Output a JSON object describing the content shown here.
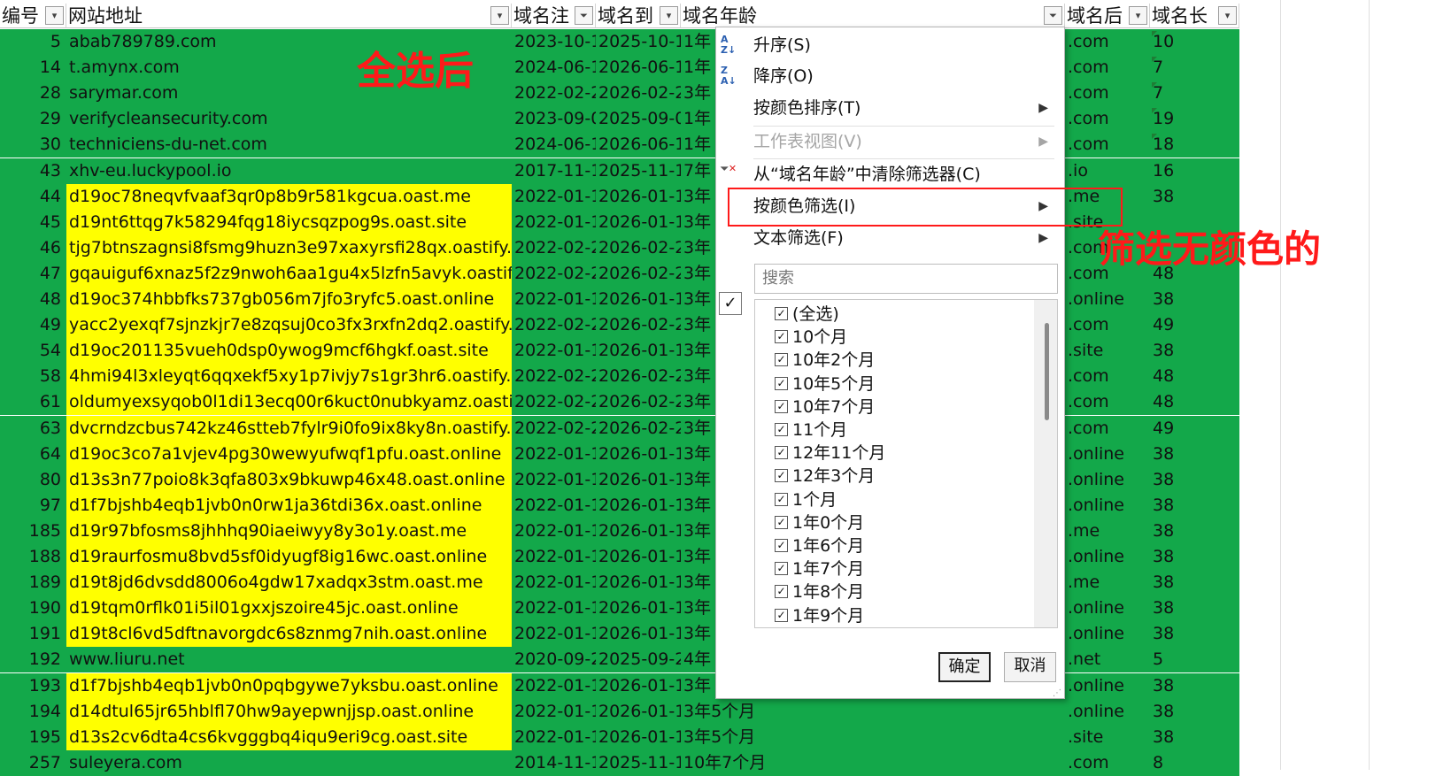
{
  "headers": [
    {
      "label": "编号",
      "filter": "▾"
    },
    {
      "label": "网站地址",
      "filter": "▾"
    },
    {
      "label": "域名注",
      "filter": "⏷"
    },
    {
      "label": "域名到",
      "filter": "▾"
    },
    {
      "label": "域名年龄",
      "filter": "⏷"
    },
    {
      "label": "域名后",
      "filter": "▾"
    },
    {
      "label": "域名长",
      "filter": "▾"
    }
  ],
  "rows": [
    {
      "id": "5",
      "url": "abab789789.com",
      "reg": "2023-10-1",
      "exp": "2025-10-1",
      "age": "1年",
      "tld": ".com",
      "len": "10",
      "hl": false
    },
    {
      "id": "14",
      "url": "t.amynx.com",
      "reg": "2024-06-1",
      "exp": "2026-06-1",
      "age": "1年",
      "tld": ".com",
      "len": "7",
      "hl": false
    },
    {
      "id": "28",
      "url": "sarymar.com",
      "reg": "2022-02-2",
      "exp": "2026-02-2",
      "age": "3年",
      "tld": ".com",
      "len": "7",
      "hl": false
    },
    {
      "id": "29",
      "url": "verifycleansecurity.com",
      "reg": "2023-09-0",
      "exp": "2025-09-0",
      "age": "1年",
      "tld": ".com",
      "len": "19",
      "hl": false
    },
    {
      "id": "30",
      "url": "techniciens-du-net.com",
      "reg": "2024-06-1",
      "exp": "2026-06-1",
      "age": "1年",
      "tld": ".com",
      "len": "18",
      "hl": false
    },
    {
      "id": "43",
      "url": "xhv-eu.luckypool.io",
      "reg": "2017-11-1",
      "exp": "2025-11-1",
      "age": "7年",
      "tld": ".io",
      "len": "16",
      "hl": false
    },
    {
      "id": "44",
      "url": "d19oc78neqvfvaaf3qr0p8b9r581kgcua.oast.me",
      "reg": "2022-01-1",
      "exp": "2026-01-1",
      "age": "3年",
      "tld": ".me",
      "len": "38",
      "hl": true
    },
    {
      "id": "45",
      "url": "d19nt6ttqg7k58294fqg18iycsqzpog9s.oast.site",
      "reg": "2022-01-1",
      "exp": "2026-01-1",
      "age": "3年",
      "tld": ".site",
      "len": "",
      "hl": true
    },
    {
      "id": "46",
      "url": "tjg7btnszagnsi8fsmg9huzn3e97xaxyrsfi28qx.oastify.com",
      "reg": "2022-02-2",
      "exp": "2026-02-2",
      "age": "3年",
      "tld": ".com",
      "len": "",
      "hl": true
    },
    {
      "id": "47",
      "url": "gqauiguf6xnaz5f2z9nwoh6aa1gu4x5lzfn5avyk.oastify.com",
      "reg": "2022-02-2",
      "exp": "2026-02-2",
      "age": "3年",
      "tld": ".com",
      "len": "48",
      "hl": true
    },
    {
      "id": "48",
      "url": "d19oc374hbbfks737gb056m7jfo3ryfc5.oast.online",
      "reg": "2022-01-1",
      "exp": "2026-01-1",
      "age": "3年",
      "tld": ".online",
      "len": "38",
      "hl": true
    },
    {
      "id": "49",
      "url": "yacc2yexqf7sjnzkjr7e8zqsuj0co3fx3rxfn2dq2.oastify.com",
      "reg": "2022-02-2",
      "exp": "2026-02-2",
      "age": "3年",
      "tld": ".com",
      "len": "49",
      "hl": true
    },
    {
      "id": "54",
      "url": "d19oc201135vueh0dsp0ywog9mcf6hgkf.oast.site",
      "reg": "2022-01-1",
      "exp": "2026-01-1",
      "age": "3年",
      "tld": ".site",
      "len": "38",
      "hl": true
    },
    {
      "id": "58",
      "url": "4hmi94l3xleyqt6qqxekf5xy1p7ivjy7s1gr3hr6.oastify.com",
      "reg": "2022-02-2",
      "exp": "2026-02-2",
      "age": "3年",
      "tld": ".com",
      "len": "48",
      "hl": true
    },
    {
      "id": "61",
      "url": "oldumyexsyqob0l1di13ecq00r6kuct0nubkyamz.oastify.com",
      "reg": "2022-02-2",
      "exp": "2026-02-2",
      "age": "3年",
      "tld": ".com",
      "len": "48",
      "hl": true
    },
    {
      "id": "63",
      "url": "dvcrndzcbus742kz46stteb7fylr9i0fo9ix8ky8n.oastify.com",
      "reg": "2022-02-2",
      "exp": "2026-02-2",
      "age": "3年",
      "tld": ".com",
      "len": "49",
      "hl": true
    },
    {
      "id": "64",
      "url": "d19oc3co7a1vjev4pg30wewyufwqf1pfu.oast.online",
      "reg": "2022-01-1",
      "exp": "2026-01-1",
      "age": "3年",
      "tld": ".online",
      "len": "38",
      "hl": true
    },
    {
      "id": "80",
      "url": "d13s3n77poio8k3qfa803x9bkuwp46x48.oast.online",
      "reg": "2022-01-1",
      "exp": "2026-01-1",
      "age": "3年",
      "tld": ".online",
      "len": "38",
      "hl": true
    },
    {
      "id": "97",
      "url": "d1f7bjshb4eqb1jvb0n0rw1ja36tdi36x.oast.online",
      "reg": "2022-01-1",
      "exp": "2026-01-1",
      "age": "3年",
      "tld": ".online",
      "len": "38",
      "hl": true
    },
    {
      "id": "185",
      "url": "d19r97bfosms8jhhhq90iaeiwyy8y3o1y.oast.me",
      "reg": "2022-01-1",
      "exp": "2026-01-1",
      "age": "3年",
      "tld": ".me",
      "len": "38",
      "hl": true
    },
    {
      "id": "188",
      "url": "d19raurfosmu8bvd5sf0idyugf8ig16wc.oast.online",
      "reg": "2022-01-1",
      "exp": "2026-01-1",
      "age": "3年",
      "tld": ".online",
      "len": "38",
      "hl": true
    },
    {
      "id": "189",
      "url": "d19t8jd6dvsdd8006o4gdw17xadqx3stm.oast.me",
      "reg": "2022-01-1",
      "exp": "2026-01-1",
      "age": "3年",
      "tld": ".me",
      "len": "38",
      "hl": true
    },
    {
      "id": "190",
      "url": "d19tqm0rflk01i5il01gxxjszoire45jc.oast.online",
      "reg": "2022-01-1",
      "exp": "2026-01-1",
      "age": "3年",
      "tld": ".online",
      "len": "38",
      "hl": true
    },
    {
      "id": "191",
      "url": "d19t8cl6vd5dftnavorgdc6s8znmg7nih.oast.online",
      "reg": "2022-01-1",
      "exp": "2026-01-1",
      "age": "3年",
      "tld": ".online",
      "len": "38",
      "hl": true
    },
    {
      "id": "192",
      "url": "www.liuru.net",
      "reg": "2020-09-2",
      "exp": "2025-09-2",
      "age": "4年",
      "tld": ".net",
      "len": "5",
      "hl": false
    },
    {
      "id": "193",
      "url": "d1f7bjshb4eqb1jvb0n0pqbgywe7yksbu.oast.online",
      "reg": "2022-01-1",
      "exp": "2026-01-1",
      "age": "3年",
      "tld": ".online",
      "len": "38",
      "hl": true
    },
    {
      "id": "194",
      "url": "d14dtul65jr65hblfl70hw9ayepwnjjsp.oast.online",
      "reg": "2022-01-1",
      "exp": "2026-01-1",
      "age": "3年5个月",
      "tld": ".online",
      "len": "38",
      "hl": true
    },
    {
      "id": "195",
      "url": "d13s2cv6dta4cs6kvgggbq4iqu9eri9cg.oast.site",
      "reg": "2022-01-1",
      "exp": "2026-01-1",
      "age": "3年5个月",
      "tld": ".site",
      "len": "38",
      "hl": true
    },
    {
      "id": "257",
      "url": "suleyera.com",
      "reg": "2014-11-1",
      "exp": "2025-11-1",
      "age": "10年7个月",
      "tld": ".com",
      "len": "8",
      "hl": false
    }
  ],
  "annotations": {
    "after_select_all": "全选后",
    "filter_no_color": "筛选无颜色的"
  },
  "menu": {
    "sort_asc": "升序(S)",
    "sort_desc": "降序(O)",
    "sort_by_color": "按颜色排序(T)",
    "sheet_view": "工作表视图(V)",
    "clear_filter": "从“域名年龄”中清除筛选器(C)",
    "filter_by_color": "按颜色筛选(I)",
    "text_filter": "文本筛选(F)",
    "search_placeholder": "搜索",
    "values": [
      "(全选)",
      "10个月",
      "10年2个月",
      "10年5个月",
      "10年7个月",
      "11个月",
      "12年11个月",
      "12年3个月",
      "1个月",
      "1年0个月",
      "1年6个月",
      "1年7个月",
      "1年8个月",
      "1年9个月"
    ],
    "ok_label": "确定",
    "cancel_label": "取消"
  },
  "colors": {
    "green": "#13a84a",
    "yellow": "#ffff00",
    "annotation_red": "#ff1a1a"
  }
}
